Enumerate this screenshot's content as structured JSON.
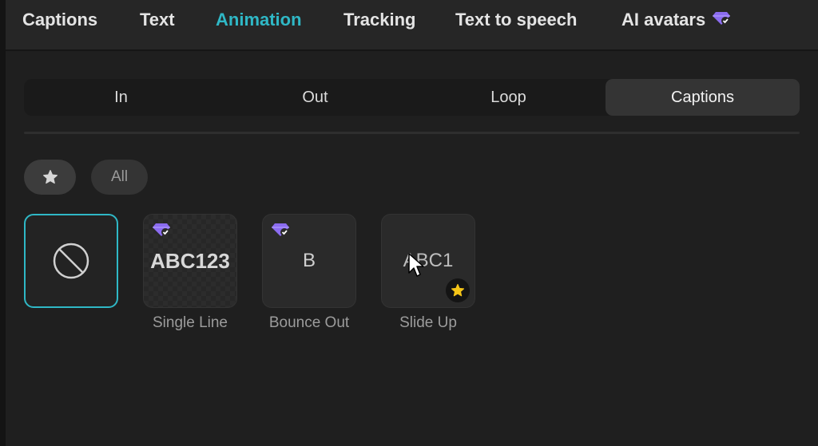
{
  "top_tabs": [
    {
      "label": "Captions"
    },
    {
      "label": "Text"
    },
    {
      "label": "Animation"
    },
    {
      "label": "Tracking"
    },
    {
      "label": "Text to speech"
    },
    {
      "label": "AI avatars"
    }
  ],
  "active_top_tab": "Animation",
  "segment_tabs": [
    {
      "label": "In"
    },
    {
      "label": "Out"
    },
    {
      "label": "Loop"
    },
    {
      "label": "Captions"
    }
  ],
  "active_segment": "Captions",
  "filters": {
    "favorites_icon": "star-icon",
    "all_label": "All"
  },
  "animations": [
    {
      "label": "",
      "preview": "none-icon",
      "selected": true
    },
    {
      "label": "Single Line",
      "preview_text": "ABC123",
      "premium": true
    },
    {
      "label": "Bounce Out",
      "preview_text": "B",
      "premium": true
    },
    {
      "label": "Slide Up",
      "preview_text": "ABC1",
      "favorite": true
    }
  ],
  "colors": {
    "accent": "#2fb8c6",
    "premium": "#8b6cf0",
    "favorite": "#f5c518",
    "background": "#1f1f1f"
  }
}
